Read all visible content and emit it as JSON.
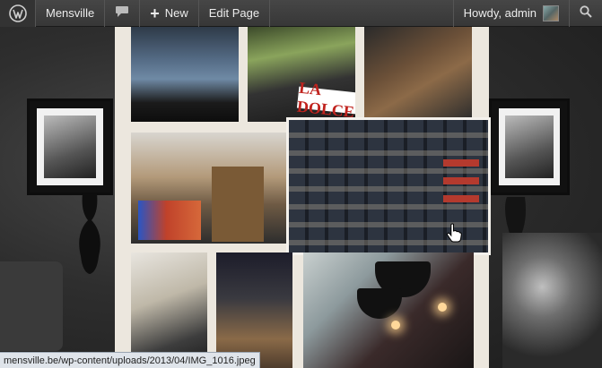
{
  "adminbar": {
    "site_name": "Mensville",
    "new_label": "New",
    "edit_label": "Edit Page",
    "greeting": "Howdy, admin"
  },
  "collage": {
    "sign_text": "LA DOLCE"
  },
  "statusbar": {
    "url": "mensville.be/wp-content/uploads/2013/04/IMG_1016.jpeg"
  },
  "icons": {
    "wp": "wordpress-logo-icon",
    "comments": "comment-bubble-icon",
    "new": "plus-icon",
    "search": "search-icon",
    "cursor": "hand-pointer-icon"
  },
  "colors": {
    "adminbar_bg": "#464646",
    "collage_bg": "#ece7de",
    "statusbar_bg": "#dfe4ea"
  }
}
